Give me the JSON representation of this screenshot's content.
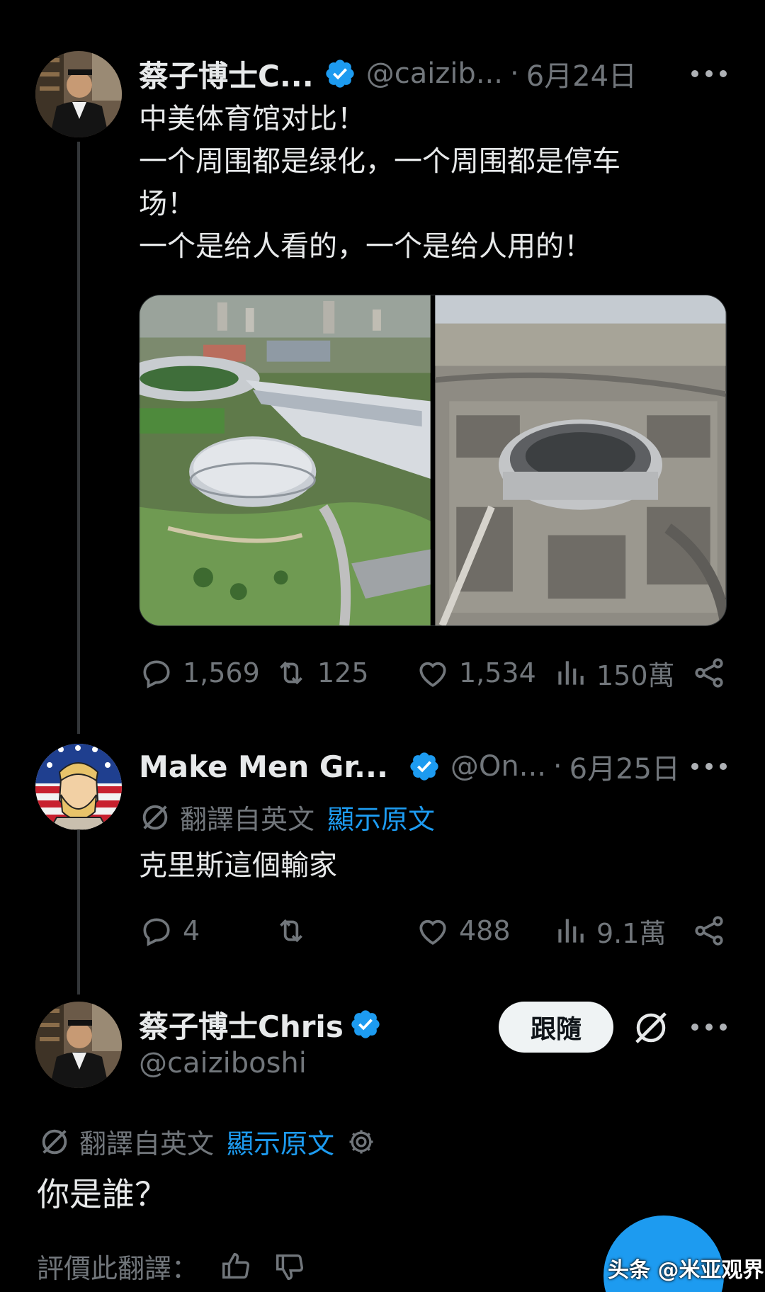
{
  "tweet1": {
    "name": "蔡子博士C...",
    "handle": "@caizib...",
    "dot": "·",
    "date": "6月24日",
    "lines": [
      "中美体育馆对比！",
      "一个周围都是绿化，一个周围都是停车",
      "场！",
      "一个是给人看的，一个是给人用的！"
    ],
    "stats": {
      "replies": "1,569",
      "retweets": "125",
      "likes": "1,534",
      "views": "150萬"
    }
  },
  "tweet2": {
    "name": "Make Men Gr...",
    "handle": "@On...",
    "dot": "·",
    "date": "6月25日",
    "translated_label": "翻譯自英文",
    "show_original": "顯示原文",
    "text": "克里斯這個輸家",
    "stats": {
      "replies": "4",
      "retweets": "",
      "likes": "488",
      "views": "9.1萬"
    }
  },
  "tweet3": {
    "name": "蔡子博士Chris",
    "handle": "@caiziboshi",
    "follow_label": "跟隨",
    "translated_label": "翻譯自英文",
    "show_original": "顯示原文",
    "text": "你是誰？",
    "rate_label": "評價此翻譯："
  },
  "watermark": "头条 @米亚观界",
  "colors": {
    "background": "#000000",
    "accent": "#1d9bf0",
    "muted": "#71767b",
    "text": "#e7e9ea"
  },
  "icons": [
    "reply-icon",
    "retweet-icon",
    "like-icon",
    "views-icon",
    "share-icon",
    "verified-badge-icon",
    "translate-icon",
    "gear-icon",
    "thumbs-up-icon",
    "thumbs-down-icon",
    "more-icon"
  ]
}
